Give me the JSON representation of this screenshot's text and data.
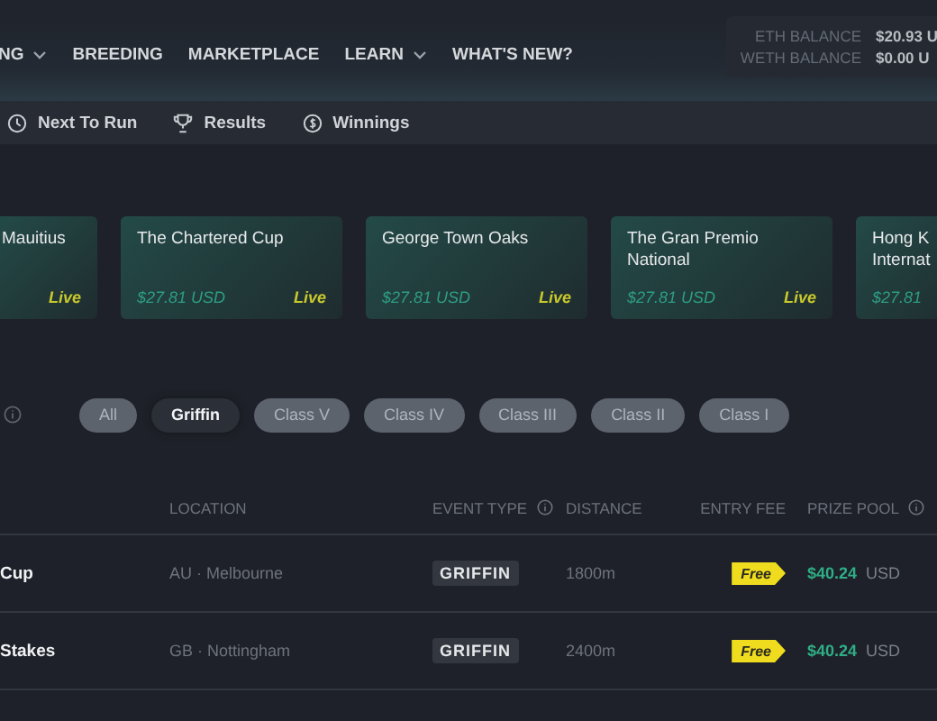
{
  "nav": {
    "items": [
      {
        "label": "NG",
        "dropdown": true
      },
      {
        "label": "BREEDING",
        "dropdown": false
      },
      {
        "label": "MARKETPLACE",
        "dropdown": false
      },
      {
        "label": "LEARN",
        "dropdown": true
      },
      {
        "label": "WHAT'S NEW?",
        "dropdown": false
      }
    ],
    "balances": [
      {
        "label": "ETH BALANCE",
        "value": "$20.93 U"
      },
      {
        "label": "WETH BALANCE",
        "value": "$0.00 U"
      }
    ]
  },
  "subnav": [
    {
      "label": "Next To Run",
      "kind": "clock"
    },
    {
      "label": "Results",
      "kind": "trophy"
    },
    {
      "label": "Winnings",
      "kind": "dollar"
    }
  ],
  "events": [
    {
      "title": "Mauitius",
      "status": "Live"
    },
    {
      "title": "The Chartered Cup",
      "price": "$27.81 USD",
      "status": "Live"
    },
    {
      "title": "George Town Oaks",
      "price": "$27.81 USD",
      "status": "Live"
    },
    {
      "title": "The Gran Premio National",
      "price": "$27.81 USD",
      "status": "Live"
    },
    {
      "title": "Hong K Internat",
      "price": "$27.81"
    }
  ],
  "filters": [
    {
      "label": "All",
      "selected": false
    },
    {
      "label": "Griffin",
      "selected": true
    },
    {
      "label": "Class V",
      "selected": false
    },
    {
      "label": "Class IV",
      "selected": false
    },
    {
      "label": "Class III",
      "selected": false
    },
    {
      "label": "Class II",
      "selected": false
    },
    {
      "label": "Class I",
      "selected": false
    }
  ],
  "table": {
    "columns": [
      {
        "label": "LOCATION",
        "info": false
      },
      {
        "label": "EVENT TYPE",
        "info": true
      },
      {
        "label": "DISTANCE",
        "info": false
      },
      {
        "label": "ENTRY FEE",
        "info": false
      },
      {
        "label": "PRIZE POOL",
        "info": true
      }
    ],
    "rows": [
      {
        "name": "Cup",
        "location": "AU · Melbourne",
        "event_type": "GRIFFIN",
        "distance": "1800m",
        "entry_fee": "Free",
        "prize": "$40.24",
        "currency": "USD"
      },
      {
        "name": "Stakes",
        "location": "GB · Nottingham",
        "event_type": "GRIFFIN",
        "distance": "2400m",
        "entry_fee": "Free",
        "prize": "$40.24",
        "currency": "USD"
      }
    ]
  }
}
